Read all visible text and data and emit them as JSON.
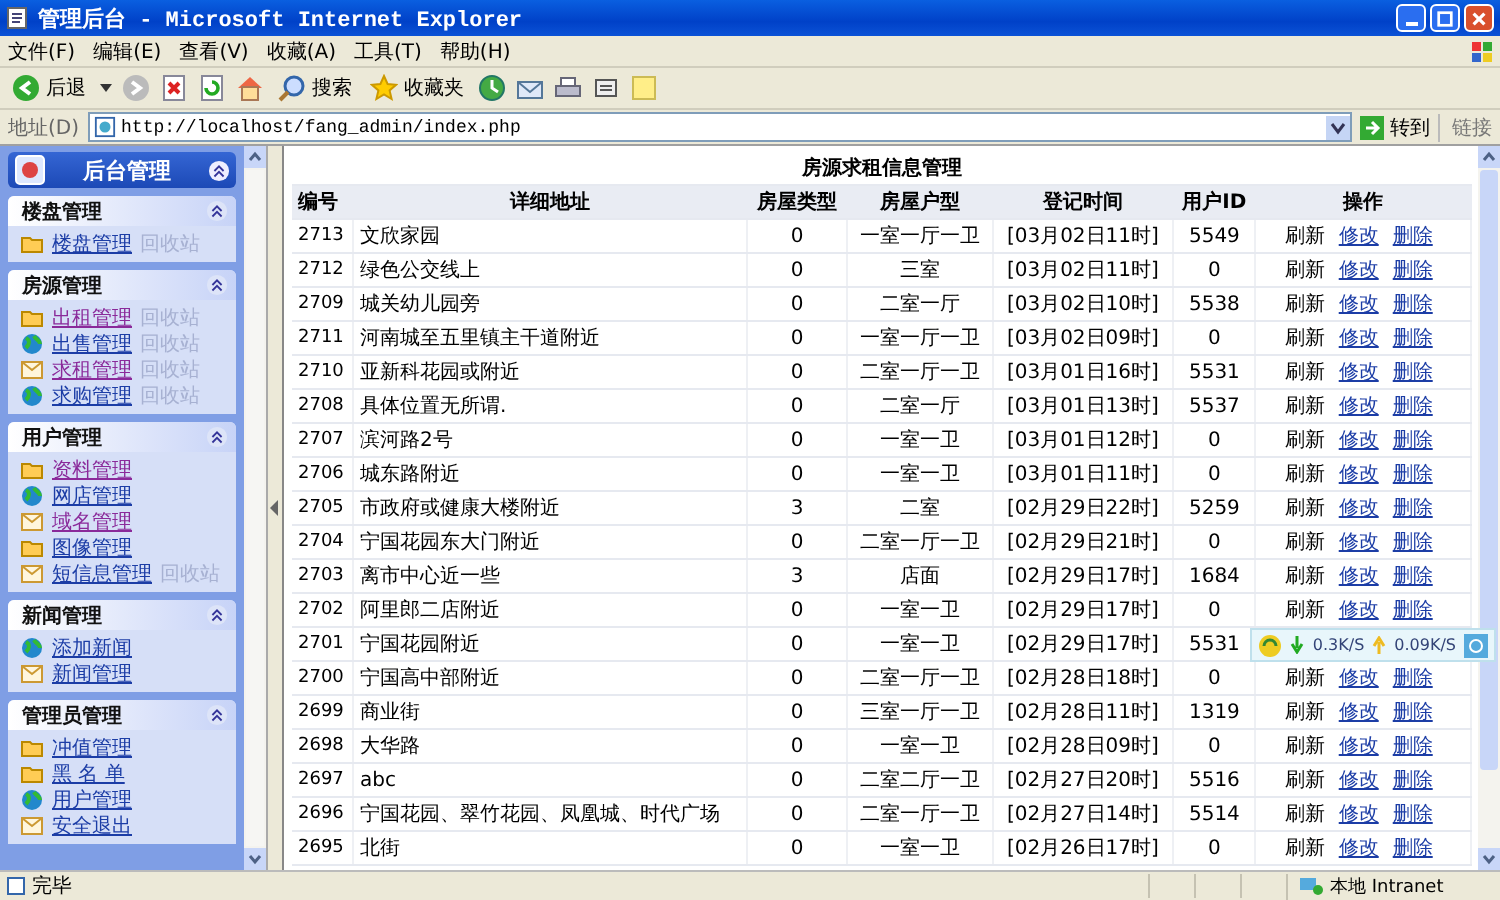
{
  "window": {
    "title": "管理后台 - Microsoft Internet Explorer"
  },
  "menu": [
    "文件(F)",
    "编辑(E)",
    "查看(V)",
    "收藏(A)",
    "工具(T)",
    "帮助(H)"
  ],
  "toolbar": {
    "back": "后退",
    "search": "搜索",
    "favorites": "收藏夹"
  },
  "address_bar": {
    "label": "地址(D)",
    "url": "http://localhost/fang_admin/index.php",
    "go": "转到",
    "links": "链接"
  },
  "sidebar": {
    "title": "后台管理",
    "sections": [
      {
        "title": "楼盘管理",
        "items": [
          {
            "label": "楼盘管理",
            "kind": "folder",
            "visited": false,
            "recycle": "回收站"
          }
        ]
      },
      {
        "title": "房源管理",
        "items": [
          {
            "label": "出租管理",
            "kind": "folder",
            "visited": true,
            "recycle": "回收站"
          },
          {
            "label": "出售管理",
            "kind": "globe",
            "visited": false,
            "recycle": "回收站"
          },
          {
            "label": "求租管理",
            "kind": "note",
            "visited": true,
            "recycle": "回收站"
          },
          {
            "label": "求购管理",
            "kind": "globe",
            "visited": false,
            "recycle": "回收站"
          }
        ]
      },
      {
        "title": "用户管理",
        "items": [
          {
            "label": "资料管理",
            "kind": "folder",
            "visited": true
          },
          {
            "label": "网店管理",
            "kind": "globe",
            "visited": false
          },
          {
            "label": "域名管理",
            "kind": "note",
            "visited": true
          },
          {
            "label": "图像管理",
            "kind": "folder",
            "visited": false
          },
          {
            "label": "短信息管理",
            "kind": "note",
            "visited": false,
            "recycle": "回收站"
          }
        ]
      },
      {
        "title": "新闻管理",
        "items": [
          {
            "label": "添加新闻",
            "kind": "globe",
            "visited": false
          },
          {
            "label": "新闻管理",
            "kind": "note",
            "visited": false
          }
        ]
      },
      {
        "title": "管理员管理",
        "items": [
          {
            "label": "冲值管理",
            "kind": "folder",
            "visited": false
          },
          {
            "label": "黑 名 单",
            "kind": "folder",
            "visited": false
          },
          {
            "label": "用户管理",
            "kind": "globe",
            "visited": false
          },
          {
            "label": "安全退出",
            "kind": "note",
            "visited": false
          }
        ]
      }
    ]
  },
  "table": {
    "title": "房源求租信息管理",
    "columns": [
      "编号",
      "详细地址",
      "房屋类型",
      "房屋户型",
      "登记时间",
      "用户ID",
      "操作"
    ],
    "rows": [
      {
        "cells": [
          "2713",
          "文欣家园",
          "0",
          "一室一厅一卫",
          "[03月02日11时]",
          "5549"
        ],
        "actions": [
          "刷新",
          "修改",
          "删除"
        ]
      },
      {
        "cells": [
          "2712",
          "绿色公交线上",
          "0",
          "三室",
          "[03月02日11时]",
          "0"
        ],
        "actions": [
          "刷新",
          "修改",
          "删除"
        ]
      },
      {
        "cells": [
          "2709",
          "城关幼儿园旁",
          "0",
          "二室一厅",
          "[03月02日10时]",
          "5538"
        ],
        "actions": [
          "刷新",
          "修改",
          "删除"
        ]
      },
      {
        "cells": [
          "2711",
          "河南城至五里镇主干道附近",
          "0",
          "一室一厅一卫",
          "[03月02日09时]",
          "0"
        ],
        "actions": [
          "刷新",
          "修改",
          "删除"
        ]
      },
      {
        "cells": [
          "2710",
          "亚新科花园或附近",
          "0",
          "二室一厅一卫",
          "[03月01日16时]",
          "5531"
        ],
        "actions": [
          "刷新",
          "修改",
          "删除"
        ]
      },
      {
        "cells": [
          "2708",
          "具体位置无所谓.",
          "0",
          "二室一厅",
          "[03月01日13时]",
          "5537"
        ],
        "actions": [
          "刷新",
          "修改",
          "删除"
        ]
      },
      {
        "cells": [
          "2707",
          "滨河路2号",
          "0",
          "一室一卫",
          "[03月01日12时]",
          "0"
        ],
        "actions": [
          "刷新",
          "修改",
          "删除"
        ]
      },
      {
        "cells": [
          "2706",
          "城东路附近",
          "0",
          "一室一卫",
          "[03月01日11时]",
          "0"
        ],
        "actions": [
          "刷新",
          "修改",
          "删除"
        ]
      },
      {
        "cells": [
          "2705",
          "市政府或健康大楼附近",
          "3",
          "二室",
          "[02月29日22时]",
          "5259"
        ],
        "actions": [
          "刷新",
          "修改",
          "删除"
        ]
      },
      {
        "cells": [
          "2704",
          "宁国花园东大门附近",
          "0",
          "二室一厅一卫",
          "[02月29日21时]",
          "0"
        ],
        "actions": [
          "刷新",
          "修改",
          "删除"
        ]
      },
      {
        "cells": [
          "2703",
          "离市中心近一些",
          "3",
          "店面",
          "[02月29日17时]",
          "1684"
        ],
        "actions": [
          "刷新",
          "修改",
          "删除"
        ]
      },
      {
        "cells": [
          "2702",
          "阿里郎二店附近",
          "0",
          "一室一卫",
          "[02月29日17时]",
          "0"
        ],
        "actions": [
          "刷新",
          "修改",
          "删除"
        ]
      },
      {
        "cells": [
          "2701",
          "宁国花园附近",
          "0",
          "一室一卫",
          "[02月29日17时]",
          "5531"
        ]
      },
      {
        "cells": [
          "2700",
          "宁国高中部附近",
          "0",
          "二室一厅一卫",
          "[02月28日18时]",
          "0"
        ],
        "actions": [
          "刷新",
          "修改",
          "删除"
        ]
      },
      {
        "cells": [
          "2699",
          "商业街",
          "0",
          "三室一厅一卫",
          "[02月28日11时]",
          "1319"
        ],
        "actions": [
          "刷新",
          "修改",
          "删除"
        ]
      },
      {
        "cells": [
          "2698",
          "大华路",
          "0",
          "一室一卫",
          "[02月28日09时]",
          "0"
        ],
        "actions": [
          "刷新",
          "修改",
          "删除"
        ]
      },
      {
        "cells": [
          "2697",
          "abc",
          "0",
          "二室二厅一卫",
          "[02月27日20时]",
          "5516"
        ],
        "actions": [
          "刷新",
          "修改",
          "删除"
        ]
      },
      {
        "cells": [
          "2696",
          "宁国花园、翠竹花园、凤凰城、时代广场",
          "0",
          "二室一厅一卫",
          "[02月27日14时]",
          "5514"
        ],
        "actions": [
          "刷新",
          "修改",
          "删除"
        ]
      },
      {
        "cells": [
          "2695",
          "北街",
          "0",
          "一室一卫",
          "[02月26日17时]",
          "0"
        ],
        "actions": [
          "刷新",
          "修改",
          "删除"
        ]
      }
    ]
  },
  "speed_widget": {
    "down": "0.3K/S",
    "up": "0.09K/S"
  },
  "status_bar": {
    "text": "完毕",
    "zone": "本地 Intranet"
  }
}
